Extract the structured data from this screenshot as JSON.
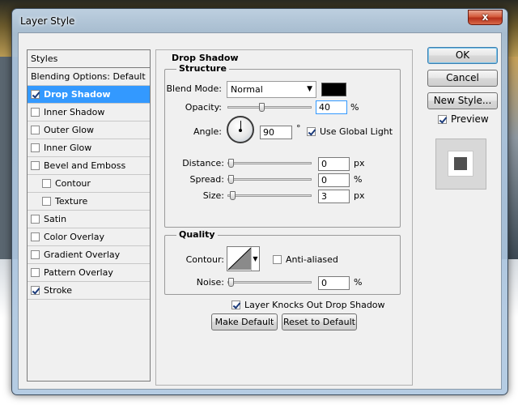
{
  "window": {
    "title": "Layer Style",
    "close_glyph": "x"
  },
  "styles_list": {
    "header": "Styles",
    "items": [
      {
        "label": "Blending Options: Default",
        "checkbox": false,
        "checked": false,
        "selected": false,
        "indent": false
      },
      {
        "label": "Drop Shadow",
        "checkbox": true,
        "checked": true,
        "selected": true,
        "indent": false
      },
      {
        "label": "Inner Shadow",
        "checkbox": true,
        "checked": false,
        "selected": false,
        "indent": false
      },
      {
        "label": "Outer Glow",
        "checkbox": true,
        "checked": false,
        "selected": false,
        "indent": false
      },
      {
        "label": "Inner Glow",
        "checkbox": true,
        "checked": false,
        "selected": false,
        "indent": false
      },
      {
        "label": "Bevel and Emboss",
        "checkbox": true,
        "checked": false,
        "selected": false,
        "indent": false
      },
      {
        "label": "Contour",
        "checkbox": true,
        "checked": false,
        "selected": false,
        "indent": true
      },
      {
        "label": "Texture",
        "checkbox": true,
        "checked": false,
        "selected": false,
        "indent": true
      },
      {
        "label": "Satin",
        "checkbox": true,
        "checked": false,
        "selected": false,
        "indent": false
      },
      {
        "label": "Color Overlay",
        "checkbox": true,
        "checked": false,
        "selected": false,
        "indent": false
      },
      {
        "label": "Gradient Overlay",
        "checkbox": true,
        "checked": false,
        "selected": false,
        "indent": false
      },
      {
        "label": "Pattern Overlay",
        "checkbox": true,
        "checked": false,
        "selected": false,
        "indent": false
      },
      {
        "label": "Stroke",
        "checkbox": true,
        "checked": true,
        "selected": false,
        "indent": false
      }
    ]
  },
  "drop_shadow": {
    "panel_title": "Drop Shadow",
    "structure": {
      "title": "Structure",
      "blend_mode_label": "Blend Mode:",
      "blend_mode_value": "Normal",
      "shadow_color": "#000000",
      "opacity_label": "Opacity:",
      "opacity_value": "40",
      "opacity_unit": "%",
      "opacity_fraction": 0.4,
      "angle_label": "Angle:",
      "angle_value": "90",
      "angle_unit": "°",
      "use_global_light_label": "Use Global Light",
      "use_global_light_checked": true,
      "distance_label": "Distance:",
      "distance_value": "0",
      "distance_unit": "px",
      "spread_label": "Spread:",
      "spread_value": "0",
      "spread_unit": "%",
      "size_label": "Size:",
      "size_value": "3",
      "size_unit": "px"
    },
    "quality": {
      "title": "Quality",
      "contour_label": "Contour:",
      "anti_aliased_label": "Anti-aliased",
      "anti_aliased_checked": false,
      "noise_label": "Noise:",
      "noise_value": "0",
      "noise_unit": "%"
    },
    "knocks_out_label": "Layer Knocks Out Drop Shadow",
    "knocks_out_checked": true,
    "make_default_label": "Make Default",
    "reset_default_label": "Reset to Default"
  },
  "buttons": {
    "ok_label": "OK",
    "cancel_label": "Cancel",
    "new_style_label": "New Style...",
    "preview_label": "Preview",
    "preview_checked": true
  },
  "colors": {
    "selection": "#3399ff",
    "default_button_border": "#3c7fb1"
  }
}
